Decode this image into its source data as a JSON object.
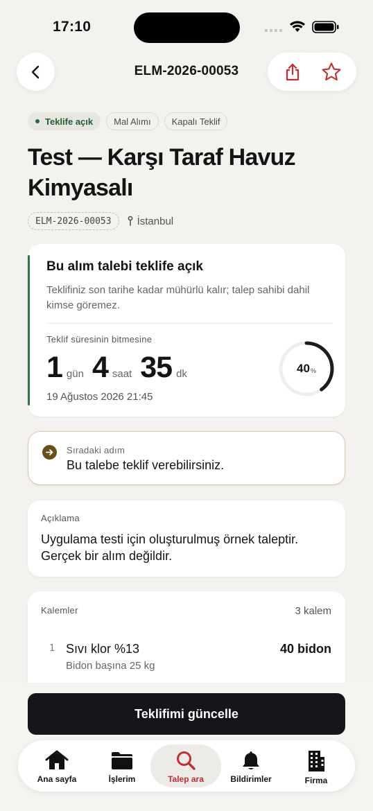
{
  "status": {
    "time": "17:10"
  },
  "header": {
    "title": "ELM-2026-00053"
  },
  "chips": [
    {
      "label": "Teklife açık"
    },
    {
      "label": "Mal Alımı"
    },
    {
      "label": "Kapalı Teklif"
    }
  ],
  "title": "Test — Karşı Taraf Havuz Kimyasalı",
  "meta": {
    "code": "ELM-2026-00053",
    "location": "İstanbul"
  },
  "open_card": {
    "title": "Bu alım talebi teklife açık",
    "description": "Teklifiniz son tarihe kadar mühürlü kalır; talep sahibi dahil kimse göremez.",
    "countdown_label": "Teklif süresinin bitmesine",
    "days": "1",
    "days_unit": "gün",
    "hours": "4",
    "hours_unit": "saat",
    "minutes": "35",
    "minutes_unit": "dk",
    "deadline": "19 Ağustos 2026 21:45",
    "progress_value": "40",
    "progress_unit": "%",
    "progress_fraction": 0.4
  },
  "next_step": {
    "label": "Sıradaki adım",
    "text": "Bu talebe teklif verebilirsiniz."
  },
  "description_card": {
    "label": "Açıklama",
    "text": "Uygulama testi için oluşturulmuş örnek taleptir. Gerçek bir alım değildir."
  },
  "items_card": {
    "label": "Kalemler",
    "count": "3 kalem",
    "items": [
      {
        "index": "1",
        "name": "Sıvı klor %13",
        "sub": "Bidon başına 25 kg",
        "qty": "40 bidon"
      }
    ]
  },
  "cta": {
    "label": "Teklifimi güncelle"
  },
  "tabs": [
    {
      "label": "Ana sayfa",
      "icon": "home-icon"
    },
    {
      "label": "İşlerim",
      "icon": "folder-icon"
    },
    {
      "label": "Talep ara",
      "icon": "search-icon"
    },
    {
      "label": "Bildirimler",
      "icon": "bell-icon"
    },
    {
      "label": "Firma",
      "icon": "building-icon"
    }
  ],
  "colors": {
    "accent_red": "#c42d31",
    "green": "#2d7548",
    "dark": "#151619"
  }
}
